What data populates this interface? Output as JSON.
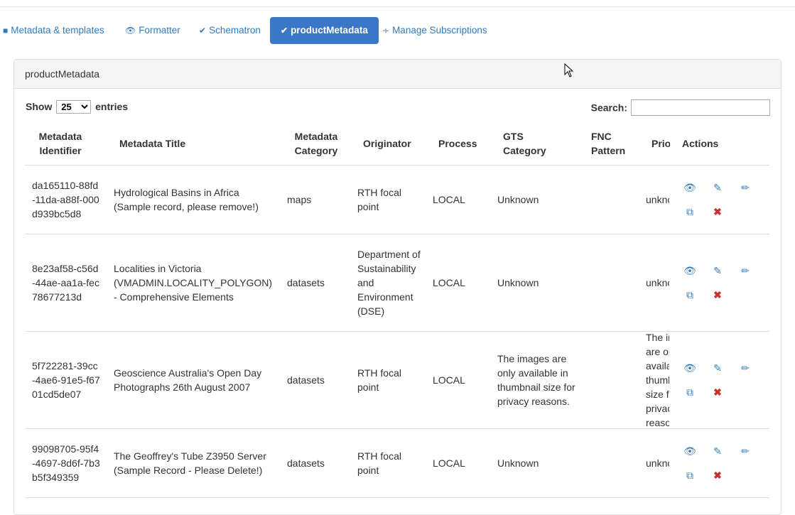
{
  "tabs": [
    {
      "label": "Metadata & templates",
      "icon": "book-icon"
    },
    {
      "label": "Formatter",
      "icon": "eye-icon"
    },
    {
      "label": "Schematron",
      "icon": "check-icon"
    },
    {
      "label": "productMetadata",
      "icon": "check-icon",
      "active": true
    },
    {
      "label": "Manage Subscriptions",
      "icon": "rss-icon"
    }
  ],
  "panel": {
    "title": "productMetadata"
  },
  "length_control": {
    "show_label": "Show",
    "value": "25",
    "entries_label": "entries"
  },
  "search": {
    "label": "Search:",
    "value": ""
  },
  "table": {
    "headers": {
      "identifier": "Metadata Identifier",
      "title": "Metadata Title",
      "category": "Metadata Category",
      "originator": "Originator",
      "process": "Process",
      "gts": "GTS Category",
      "fnc": "FNC Pattern",
      "priority": "Prio",
      "actions": "Actions"
    },
    "rows": [
      {
        "identifier": "da165110-88fd-11da-a88f-000d939bc5d8",
        "title": "Hydrological Basins in Africa (Sample record, please remove!)",
        "category": "maps",
        "originator": "RTH focal point",
        "process": "LOCAL",
        "gts": "Unknown",
        "fnc": "",
        "priority": "unknown"
      },
      {
        "identifier": "8e23af58-c56d-44ae-aa1a-fec78677213d",
        "title": "Localities in Victoria (VMADMIN.LOCALITY_POLYGON) - Comprehensive Elements",
        "category": "datasets",
        "originator": "Department of Sustainability and Environment (DSE)",
        "process": "LOCAL",
        "gts": "Unknown",
        "fnc": "",
        "priority": "unknown"
      },
      {
        "identifier": "5f722281-39cc-4ae6-91e5-f6701cd5de07",
        "title": "Geoscience Australia's Open Day Photographs 26th August 2007",
        "category": "datasets",
        "originator": "RTH focal point",
        "process": "LOCAL",
        "gts": "The images are only available in thumbnail size for privacy reasons.",
        "fnc": "",
        "priority": "The images are only available in thumbnail size for privacy reasons."
      },
      {
        "identifier": "99098705-95f4-4697-8d6f-7b3b5f349359",
        "title": "The Geoffrey's Tube Z3950 Server (Sample Record - Please Delete!)",
        "category": "datasets",
        "originator": "RTH focal point",
        "process": "LOCAL",
        "gts": "Unknown",
        "fnc": "",
        "priority": "unknown"
      }
    ]
  }
}
